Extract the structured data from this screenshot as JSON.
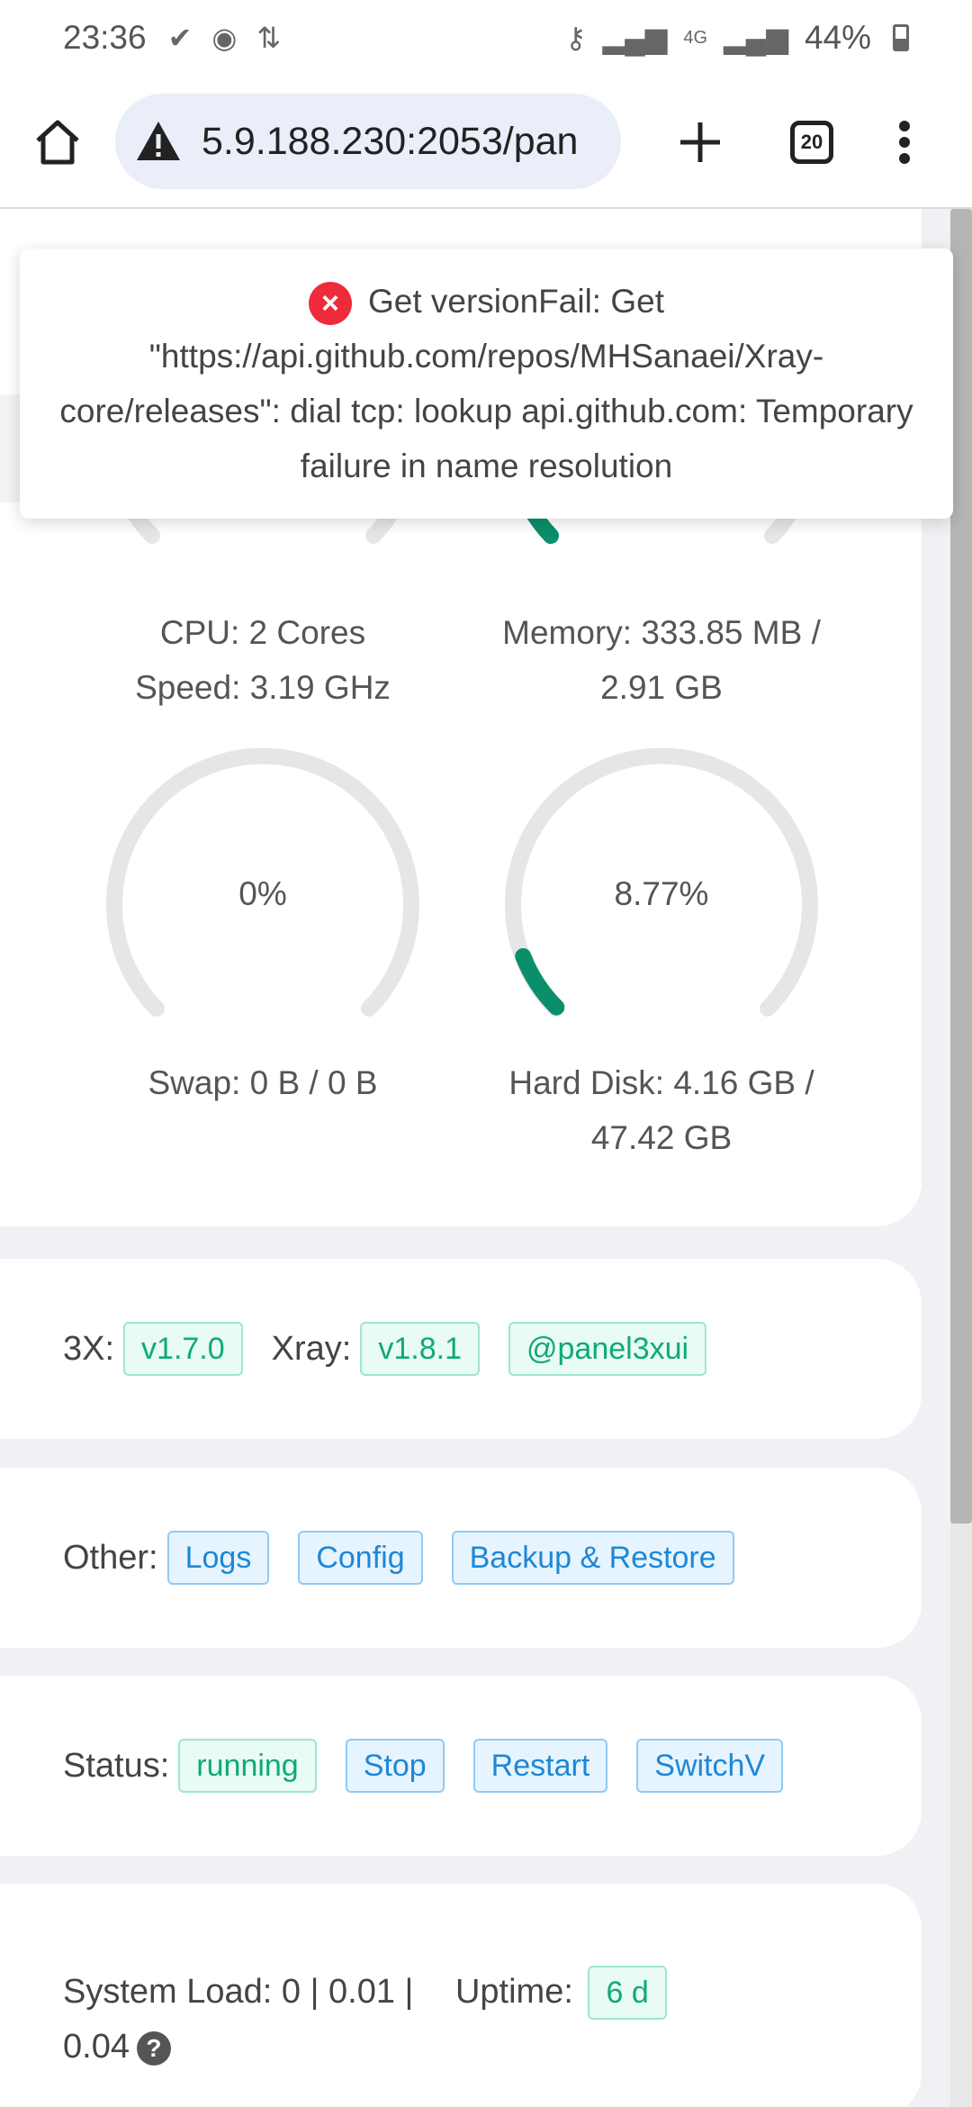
{
  "statusbar": {
    "time": "23:36",
    "battery": "44%",
    "network": "4G"
  },
  "browser": {
    "url": "5.9.188.230:2053/pan",
    "tab_count": "20"
  },
  "toast": {
    "message": "Get versionFail: Get \"https://api.github.com/repos/MHSanaei/Xray-core/releases\": dial tcp: lookup api.github.com: Temporary failure in name resolution"
  },
  "gauges": {
    "cpu": {
      "caption_line1": "CPU: 2 Cores",
      "caption_line2": "Speed: 3.19 GHz"
    },
    "memory": {
      "caption_line1": "Memory: 333.85 MB /",
      "caption_line2": "2.91 GB"
    },
    "swap": {
      "value": "0%",
      "caption_line1": "Swap: 0 B / 0 B",
      "fill_percent": 0
    },
    "disk": {
      "value": "8.77%",
      "caption_line1": "Hard Disk: 4.16 GB /",
      "caption_line2": "47.42 GB",
      "fill_percent": 8.77
    }
  },
  "versions": {
    "label_3x": "3X:",
    "v3x": "v1.7.0",
    "label_xray": "Xray:",
    "vxray": "v1.8.1",
    "channel": "@panel3xui"
  },
  "other": {
    "label": "Other:",
    "logs": "Logs",
    "config": "Config",
    "backup": "Backup & Restore"
  },
  "status": {
    "label": "Status:",
    "state": "running",
    "stop": "Stop",
    "restart": "Restart",
    "switch": "SwitchV"
  },
  "system": {
    "load_label": "System Load: 0 | 0.01 |",
    "load_rest": "0.04",
    "uptime_label": "Uptime:",
    "uptime": "6 d"
  },
  "colors": {
    "gauge_fill": "#0a8f6a",
    "gauge_track": "#e6e6e6",
    "error": "#ee2b3a"
  }
}
